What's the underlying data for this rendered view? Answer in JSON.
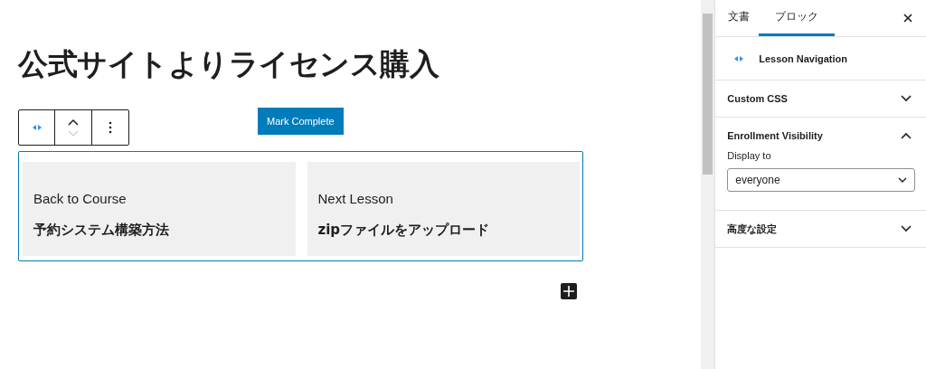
{
  "editor": {
    "title": "公式サイトよりライセンス購入",
    "mark_complete_button": "Mark Complete",
    "navigation": [
      {
        "label": "Back to Course",
        "title": "予約システム構築方法"
      },
      {
        "label": "Next Lesson",
        "title": "zipファイルをアップロード"
      }
    ]
  },
  "sidebar": {
    "tabs": [
      {
        "label": "文書",
        "selected": false
      },
      {
        "label": "ブロック",
        "selected": true
      }
    ],
    "block_name": "Lesson Navigation",
    "panels": [
      {
        "title": "Custom CSS",
        "expanded": false
      },
      {
        "title": "Enrollment Visibility",
        "expanded": true,
        "field_label": "Display to",
        "select_value": "everyone"
      },
      {
        "title": "高度な設定",
        "expanded": false
      }
    ]
  }
}
